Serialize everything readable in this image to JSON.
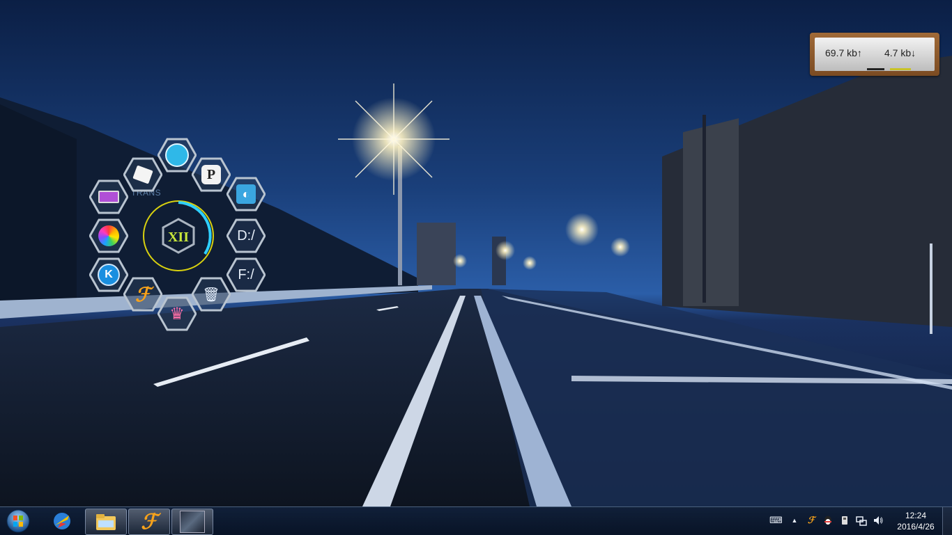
{
  "netmeter": {
    "upload": "69.7 kb↑",
    "download": "4.7 kb↓"
  },
  "launcher": {
    "center_label": "XII",
    "trans_label": "TRANS",
    "items": [
      {
        "name": "video-player-icon",
        "glyph": "🎞"
      },
      {
        "name": "p-app-icon",
        "glyph": "P"
      },
      {
        "name": "tool-app-icon",
        "glyph": "◐"
      },
      {
        "name": "drive-d-icon",
        "glyph": "D:/"
      },
      {
        "name": "drive-f-icon",
        "glyph": "F:/"
      },
      {
        "name": "recycle-bin-icon",
        "glyph": "🗑"
      },
      {
        "name": "colorful-app-icon",
        "glyph": "♛"
      },
      {
        "name": "browser-f-icon",
        "glyph": "ℱ"
      },
      {
        "name": "k-app-icon",
        "glyph": "K"
      },
      {
        "name": "pinwheel-app-icon",
        "glyph": "✿"
      },
      {
        "name": "laptop-icon",
        "glyph": "▭"
      },
      {
        "name": "paper-app-icon",
        "glyph": "▤"
      }
    ]
  },
  "taskbar": {
    "start_icon": "windows-orb-icon",
    "pinned": [
      {
        "name": "app-globe-icon"
      },
      {
        "name": "file-explorer-icon"
      },
      {
        "name": "browser-f-icon"
      },
      {
        "name": "media-thumbnail-icon"
      }
    ],
    "tray": {
      "icons": [
        "keyboard-icon",
        "show-hidden-icon",
        "browser-tray-icon",
        "qq-icon",
        "usb-icon",
        "network-icon",
        "volume-icon"
      ],
      "show_hidden_glyph": "▲"
    },
    "clock": {
      "time": "12:24",
      "date": "2016/4/26"
    }
  },
  "colors": {
    "accent_cyan": "#2fd0ff",
    "ring_yellow": "#d8d10f",
    "sky_dark": "#0a1a33"
  }
}
